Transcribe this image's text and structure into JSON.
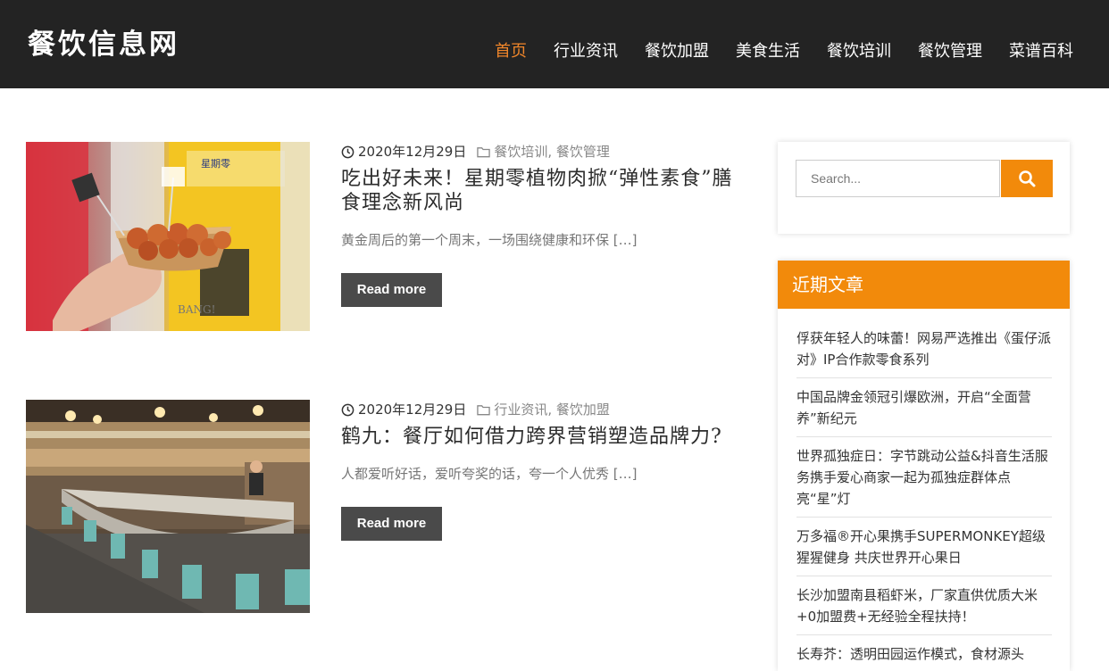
{
  "site": {
    "logo": "餐饮信息网"
  },
  "nav": {
    "items": [
      {
        "label": "首页",
        "active": true
      },
      {
        "label": "行业资讯"
      },
      {
        "label": "餐饮加盟"
      },
      {
        "label": "美食生活"
      },
      {
        "label": "餐饮培训"
      },
      {
        "label": "餐饮管理"
      },
      {
        "label": "菜谱百科"
      }
    ]
  },
  "posts": [
    {
      "date": "2020年12月29日",
      "categories": [
        "餐饮培训",
        "餐饮管理"
      ],
      "title": "吃出好未来！星期零植物肉掀“弹性素食”膳食理念新风尚",
      "excerpt": "黄金周后的第一个周末，一场围绕健康和环保 […]",
      "read_more": "Read more",
      "thumb_text": "BANG!",
      "thumb_sign": "星期零"
    },
    {
      "date": "2020年12月29日",
      "categories": [
        "行业资讯",
        "餐饮加盟"
      ],
      "title": "鹤九：餐厅如何借力跨界营销塑造品牌力?",
      "excerpt": "人都爱听好话，爱听夸奖的话，夸一个人优秀 […]",
      "read_more": "Read more"
    }
  ],
  "search": {
    "placeholder": "Search..."
  },
  "recent": {
    "title": "近期文章",
    "items": [
      "俘获年轻人的味蕾！网易严选推出《蛋仔派对》IP合作款零食系列",
      "中国品牌金领冠引爆欧洲，开启“全面营养”新纪元",
      "世界孤独症日：字节跳动公益&抖音生活服务携手爱心商家一起为孤独症群体点亮“星”灯",
      "万多福®开心果携手SUPERMONKEY超级猩猩健身 共庆世界开心果日",
      "长沙加盟南县稻虾米，厂家直供优质大米+0加盟费+无经验全程扶持！",
      "长寿芥：透明田园运作模式，食材源头"
    ]
  },
  "colors": {
    "accent": "#f28a0b",
    "header_bg": "#232323",
    "nav_active": "#f0862a",
    "button_bg": "#4a4a4a"
  }
}
